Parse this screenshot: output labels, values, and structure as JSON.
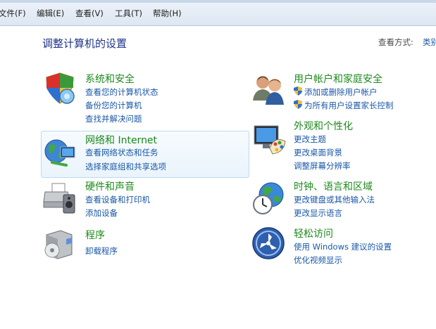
{
  "menu": [
    "文件(F)",
    "编辑(E)",
    "查看(V)",
    "工具(T)",
    "帮助(H)"
  ],
  "title": "调整计算机的设置",
  "view_by": {
    "label": "查看方式:",
    "value": "类别"
  },
  "categories": [
    {
      "title": "系统和安全",
      "icon": "shield-pc-icon",
      "links": [
        "查看您的计算机状态",
        "备份您的计算机",
        "查找并解决问题"
      ]
    },
    {
      "title": "网络和 Internet",
      "icon": "network-globe-icon",
      "links": [
        "查看网络状态和任务",
        "选择家庭组和共享选项"
      ]
    },
    {
      "title": "硬件和声音",
      "icon": "printer-speaker-icon",
      "links": [
        "查看设备和打印机",
        "添加设备"
      ]
    },
    {
      "title": "程序",
      "icon": "programs-disc-icon",
      "links": [
        "卸载程序"
      ]
    },
    {
      "title": "用户帐户和家庭安全",
      "icon": "users-icon",
      "links": [
        "添加或删除用户帐户",
        "为所有用户设置家长控制"
      ]
    },
    {
      "title": "外观和个性化",
      "icon": "monitor-palette-icon",
      "links": [
        "更改主题",
        "更改桌面背景",
        "调整屏幕分辨率"
      ]
    },
    {
      "title": "时钟、语言和区域",
      "icon": "globe-clock-icon",
      "links": [
        "更改键盘或其他输入法",
        "更改显示语言"
      ]
    },
    {
      "title": "轻松访问",
      "icon": "ease-of-access-icon",
      "links": [
        "使用 Windows 建议的设置",
        "优化视频显示"
      ]
    }
  ],
  "colors": {
    "link": "#1a57a8",
    "category": "#1c8a1c",
    "title": "#1e3287"
  }
}
